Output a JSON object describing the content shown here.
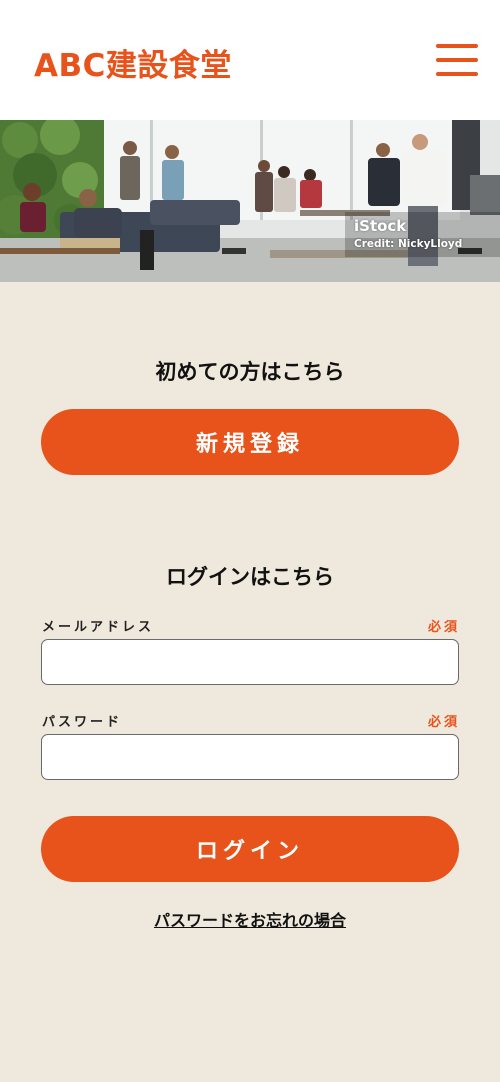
{
  "header": {
    "brand": "ABC建設食堂",
    "menu_icon": "hamburger-menu-icon",
    "brand_color": "#e8531c"
  },
  "hero": {
    "watermark": "iStock",
    "credit": "Credit: NickyLloyd"
  },
  "signup": {
    "heading": "初めての方はこちら",
    "button_label": "新規登録"
  },
  "login": {
    "heading": "ログインはこちら",
    "email_label": "メールアドレス",
    "email_required": "必須",
    "email_value": "",
    "password_label": "パスワード",
    "password_required": "必須",
    "password_value": "",
    "button_label": "ログイン",
    "forgot_link": "パスワードをお忘れの場合"
  },
  "colors": {
    "accent": "#e8531c",
    "background": "#efe8dc"
  }
}
